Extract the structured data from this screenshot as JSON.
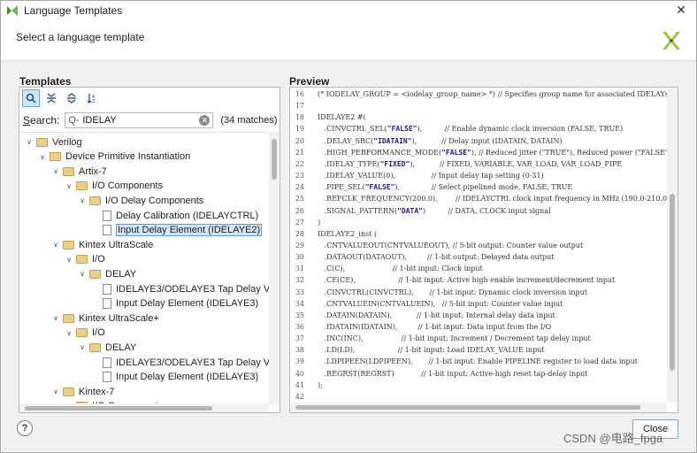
{
  "window": {
    "title": "Language Templates",
    "close_glyph": "✕"
  },
  "header": {
    "subtitle": "Select a language template"
  },
  "templates": {
    "heading": "Templates",
    "search_label_prefix": "S",
    "search_label_rest": "earch:",
    "search_value": "IDELAY",
    "search_icon_glyph": "Q-",
    "matches": "(34 matches)",
    "toolbar": [
      "search-icon",
      "collapse-all-icon",
      "expand-all-icon",
      "sort-icon"
    ],
    "tree": [
      {
        "label": "Verilog",
        "depth": 0,
        "kind": "folder",
        "expanded": true
      },
      {
        "label": "Device Primitive Instantiation",
        "depth": 1,
        "kind": "folder",
        "expanded": true
      },
      {
        "label": "Artix-7",
        "depth": 2,
        "kind": "folder",
        "expanded": true
      },
      {
        "label": "I/O Components",
        "depth": 3,
        "kind": "folder",
        "expanded": true
      },
      {
        "label": "I/O Delay Components",
        "depth": 4,
        "kind": "folder",
        "expanded": true
      },
      {
        "label": "Delay Calibration (IDELAYCTRL)",
        "depth": 5,
        "kind": "file"
      },
      {
        "label": "Input Delay Element (IDELAYE2)",
        "depth": 5,
        "kind": "file",
        "selected": true
      },
      {
        "label": "Kintex UltraScale",
        "depth": 2,
        "kind": "folder",
        "expanded": true
      },
      {
        "label": "I/O",
        "depth": 3,
        "kind": "folder",
        "expanded": true
      },
      {
        "label": "DELAY",
        "depth": 4,
        "kind": "folder",
        "expanded": true
      },
      {
        "label": "IDELAYE3/ODELAYE3 Tap Delay Value Contr",
        "depth": 5,
        "kind": "file"
      },
      {
        "label": "Input Delay Element (IDELAYE3)",
        "depth": 5,
        "kind": "file"
      },
      {
        "label": "Kintex UltraScale+",
        "depth": 2,
        "kind": "folder",
        "expanded": true
      },
      {
        "label": "I/O",
        "depth": 3,
        "kind": "folder",
        "expanded": true
      },
      {
        "label": "DELAY",
        "depth": 4,
        "kind": "folder",
        "expanded": true
      },
      {
        "label": "IDELAYE3/ODELAYE3 Tap Delay Value Contr",
        "depth": 5,
        "kind": "file"
      },
      {
        "label": "Input Delay Element (IDELAYE3)",
        "depth": 5,
        "kind": "file"
      },
      {
        "label": "Kintex-7",
        "depth": 2,
        "kind": "folder",
        "expanded": true
      },
      {
        "label": "I/O Components",
        "depth": 3,
        "kind": "folder",
        "expanded": true
      }
    ]
  },
  "preview": {
    "heading": "Preview",
    "lines": [
      {
        "n": "16",
        "text": "(* IODELAY_GROUP = <iodelay_group_name> *) // Specifies group name for associated IDELAYs/ODELA"
      },
      {
        "n": "17",
        "text": ""
      },
      {
        "n": "18",
        "text": "IDELAYE2 #("
      },
      {
        "n": "19",
        "text": "   .CINVCTRL_SEL(\"FALSE\"),          // Enable dynamic clock inversion (FALSE, TRUE)"
      },
      {
        "n": "20",
        "text": "   .DELAY_SRC(\"IDATAIN\"),           // Delay input (IDATAIN, DATAIN)"
      },
      {
        "n": "21",
        "text": "   .HIGH_PERFORMANCE_MODE(\"FALSE\"), // Reduced jitter (\"TRUE\"), Reduced power (\"FALSE\")"
      },
      {
        "n": "22",
        "text": "   .IDELAY_TYPE(\"FIXED\"),           // FIXED, VARIABLE, VAR_LOAD, VAR_LOAD_PIPE"
      },
      {
        "n": "23",
        "text": "   .IDELAY_VALUE(0),                // Input delay tap setting (0-31)"
      },
      {
        "n": "24",
        "text": "   .PIPE_SEL(\"FALSE\"),              // Select pipelined mode, FALSE, TRUE"
      },
      {
        "n": "25",
        "text": "   .REFCLK_FREQUENCY(200.0),        // IDELAYCTRL clock input frequency in MHz (190.0-210.0, 29"
      },
      {
        "n": "26",
        "text": "   .SIGNAL_PATTERN(\"DATA\")          // DATA, CLOCK input signal"
      },
      {
        "n": "27",
        "text": ")"
      },
      {
        "n": "28",
        "text": "IDELAYE2_inst ("
      },
      {
        "n": "29",
        "text": "   .CNTVALUEOUT(CNTVALUEOUT), // 5-bit output: Counter value output"
      },
      {
        "n": "30",
        "text": "   .DATAOUT(DATAOUT),         // 1-bit output: Delayed data output"
      },
      {
        "n": "31",
        "text": "   .C(C),                     // 1-bit input: Clock input"
      },
      {
        "n": "32",
        "text": "   .CE(CE),                   // 1-bit input: Active high enable increment/decrement input"
      },
      {
        "n": "33",
        "text": "   .CINVCTRL(CINVCTRL),       // 1-bit input: Dynamic clock inversion input"
      },
      {
        "n": "34",
        "text": "   .CNTVALUEIN(CNTVALUEIN),   // 5-bit input: Counter value input"
      },
      {
        "n": "35",
        "text": "   .DATAIN(DATAIN),           // 1-bit input: Internal delay data input"
      },
      {
        "n": "36",
        "text": "   .IDATAIN(IDATAIN),         // 1-bit input: Data input from the I/O"
      },
      {
        "n": "37",
        "text": "   .INC(INC),                 // 1-bit input: Increment / Decrement tap delay input"
      },
      {
        "n": "38",
        "text": "   .LD(LD),                   // 1-bit input: Load IDELAY_VALUE input"
      },
      {
        "n": "39",
        "text": "   .LDPIPEEN(LDPIPEEN),       // 1-bit input: Enable PIPELINE register to load data input"
      },
      {
        "n": "40",
        "text": "   .REGRST(REGRST)            // 1-bit input: Active-high reset tap-delay input"
      },
      {
        "n": "41",
        "text": ");"
      },
      {
        "n": "42",
        "text": ""
      }
    ]
  },
  "footer": {
    "help_label": "?",
    "close_label": "Close"
  },
  "watermark": "CSDN @电路_fpga",
  "colors": {
    "accent": "#66a7d8",
    "selection": "#cfe6fb",
    "string": "#1a1a8a"
  }
}
